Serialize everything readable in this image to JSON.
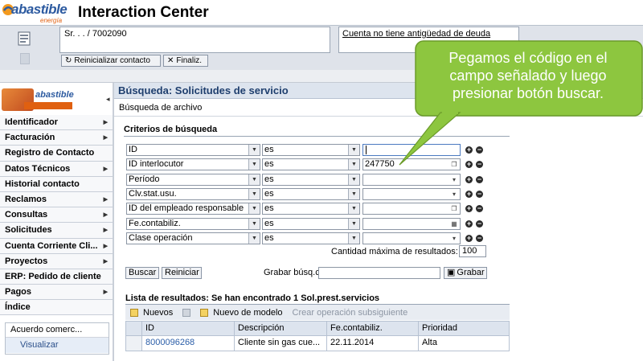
{
  "header": {
    "logo_brand": "abastible",
    "logo_tagline": "energía limpia",
    "app_title": "Interaction Center"
  },
  "context": {
    "customer": "Sr. . . / 7002090",
    "debt_status": "Cuenta no tiene antigüedad de deuda",
    "reset_button": "Reinicializar contacto",
    "finish_button": "Finaliz."
  },
  "nav": {
    "logo_brand": "abastible",
    "items": [
      {
        "label": "Identificador",
        "arrow": true
      },
      {
        "label": "Facturación",
        "arrow": true
      },
      {
        "label": "Registro de Contacto",
        "arrow": false
      },
      {
        "label": "Datos Técnicos",
        "arrow": true
      },
      {
        "label": "Historial contacto",
        "arrow": false
      },
      {
        "label": "Reclamos",
        "arrow": true
      },
      {
        "label": "Consultas",
        "arrow": true
      },
      {
        "label": "Solicitudes",
        "arrow": true
      },
      {
        "label": "Cuenta Corriente Cli...",
        "arrow": true
      },
      {
        "label": "Proyectos",
        "arrow": true
      },
      {
        "label": "ERP: Pedido de cliente",
        "arrow": false
      },
      {
        "label": "Pagos",
        "arrow": true
      },
      {
        "label": "Índice",
        "arrow": false
      }
    ],
    "sub_title": "Acuerdo comerc...",
    "sub_action": "Visualizar"
  },
  "main": {
    "title": "Búsqueda: Solicitudes de servicio",
    "subtitle": "Búsqueda de archivo",
    "criteria_title": "Criterios de búsqueda",
    "criteria": [
      {
        "field": "ID",
        "op": "es",
        "value": "",
        "focused": true,
        "value_icon": ""
      },
      {
        "field": "ID interlocutor",
        "op": "es",
        "value": "247750",
        "focused": false,
        "value_icon": "❐"
      },
      {
        "field": "Período",
        "op": "es",
        "value": "",
        "focused": false,
        "value_icon": "▾"
      },
      {
        "field": "Clv.stat.usu.",
        "op": "es",
        "value": "",
        "focused": false,
        "value_icon": "▾"
      },
      {
        "field": "ID del empleado responsable",
        "op": "es",
        "value": "",
        "focused": false,
        "value_icon": "❐"
      },
      {
        "field": "Fe.contabiliz.",
        "op": "es",
        "value": "",
        "focused": false,
        "value_icon": "▦"
      },
      {
        "field": "Clase operación",
        "op": "es",
        "value": "",
        "focused": false,
        "value_icon": "▾"
      }
    ],
    "max_results_label": "Cantidad máxima de resultados:",
    "max_results_value": "100",
    "search_button": "Buscar",
    "reset_button": "Reiniciar",
    "save_search_label": "Grabar búsq.como:",
    "save_button": "Grabar",
    "results_title": "Lista de resultados: Se han encontrado 1 Sol.prest.servicios",
    "toolbar": {
      "new": "Nuevos",
      "new_from_template": "Nuevo de modelo",
      "create_follow_up": "Crear operación subsiguiente"
    },
    "columns": [
      "ID",
      "Descripción",
      "Fe.contabiliz.",
      "Prioridad"
    ],
    "rows": [
      {
        "id": "8000096268",
        "description": "Cliente sin gas cue...",
        "date": "22.11.2014",
        "priority": "Alta"
      }
    ]
  },
  "callout": {
    "text": "Pegamos el código en el campo señalado y luego presionar botón buscar.",
    "color": "#8dc63f"
  }
}
